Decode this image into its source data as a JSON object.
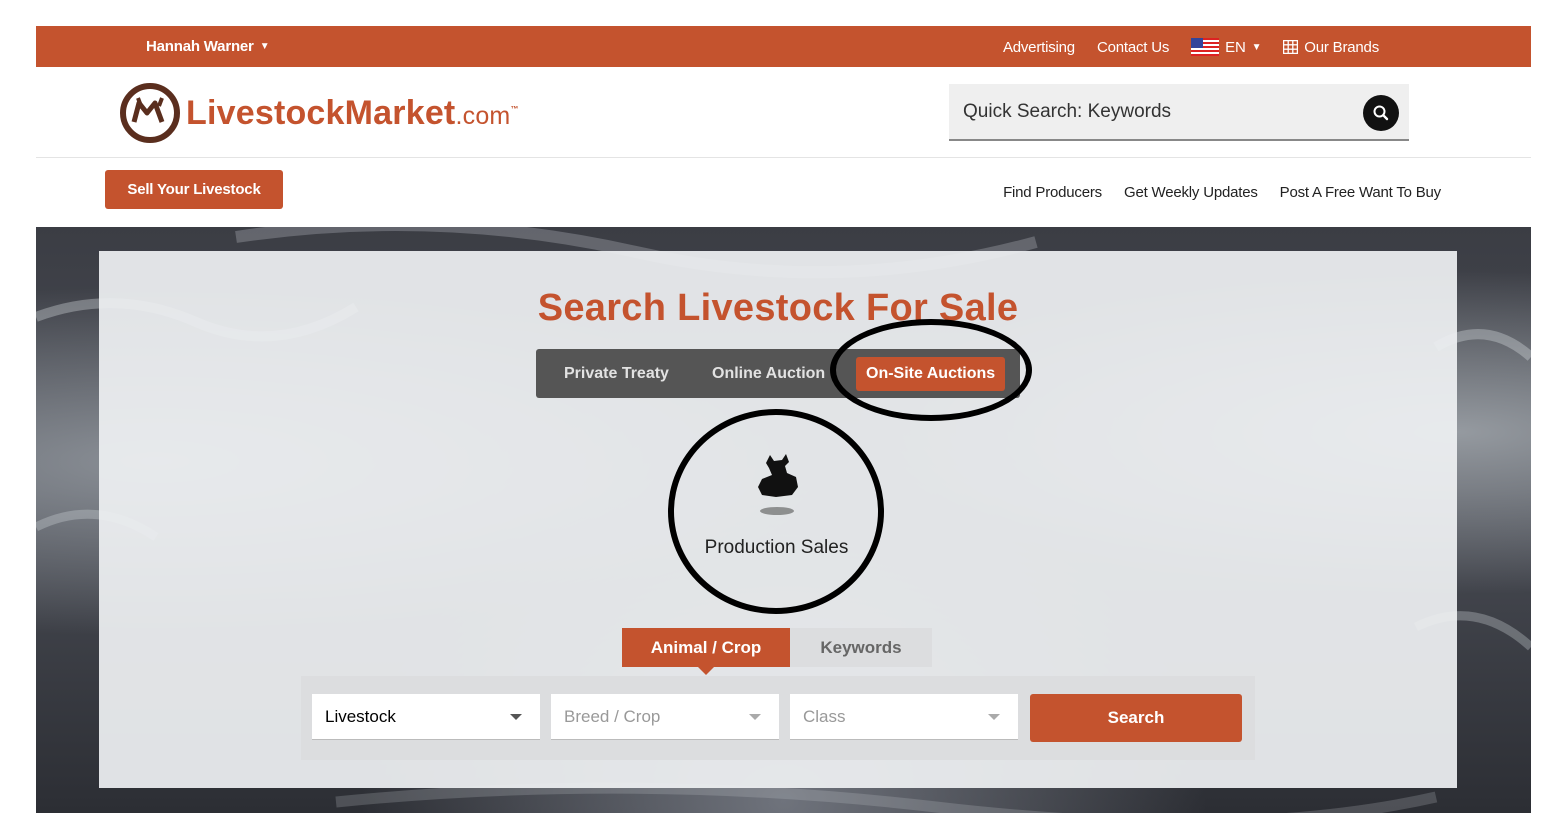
{
  "topbar": {
    "user_name": "Hannah Warner",
    "advertising": "Advertising",
    "contact": "Contact Us",
    "language": "EN",
    "brands": "Our Brands"
  },
  "header": {
    "logo_name": "LivestockMarket",
    "logo_tld": ".com",
    "logo_tm": "™",
    "search_placeholder": "Quick Search: Keywords"
  },
  "subnav": {
    "sell_button": "Sell Your Livestock",
    "links": [
      "Find Producers",
      "Get Weekly Updates",
      "Post A Free Want To Buy"
    ]
  },
  "hero": {
    "title": "Search Livestock For Sale",
    "tabs": [
      "Private Treaty",
      "Online Auction",
      "On-Site Auctions"
    ],
    "active_tab": "On-Site Auctions",
    "category_label": "Production Sales",
    "search_tabs": [
      "Animal / Crop",
      "Keywords"
    ],
    "active_search_tab": "Animal / Crop",
    "selects": {
      "type": "Livestock",
      "breed_placeholder": "Breed / Crop",
      "class_placeholder": "Class"
    },
    "search_button": "Search"
  },
  "colors": {
    "brand": "#c4532e",
    "dark_tab_bar": "#555555"
  },
  "icons": [
    "caret-down-icon",
    "us-flag-icon",
    "grid-icon",
    "search-icon",
    "livestock-icon"
  ]
}
